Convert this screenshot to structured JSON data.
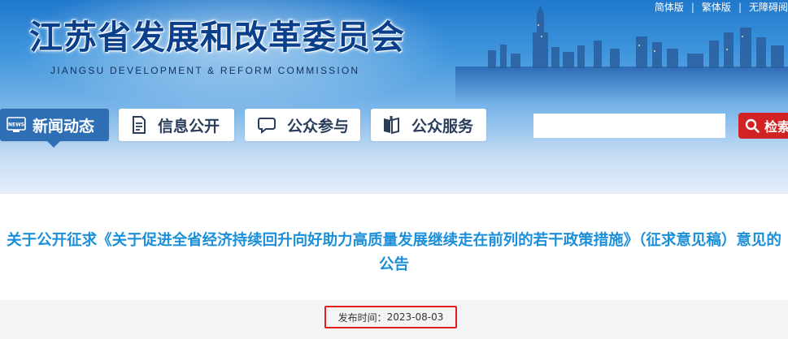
{
  "header": {
    "title": "江苏省发展和改革委员会",
    "subtitle": "JIANGSU DEVELOPMENT & REFORM COMMISSION",
    "top_links": [
      "简体版",
      "繁体版",
      "无障碍阅"
    ]
  },
  "nav": {
    "items": [
      {
        "label": "新闻动态",
        "icon": "news-icon",
        "active": true
      },
      {
        "label": "信息公开",
        "icon": "document-icon",
        "active": false
      },
      {
        "label": "公众参与",
        "icon": "chat-icon",
        "active": false
      },
      {
        "label": "公众服务",
        "icon": "book-icon",
        "active": false
      }
    ],
    "news_badge": "NEWS"
  },
  "search": {
    "placeholder": "",
    "value": "",
    "button_label": "检索"
  },
  "article": {
    "title": "关于公开征求《关于促进全省经济持续回升向好助力高质量发展继续走在前列的若干政策措施》（征求意见稿）意见的公告",
    "publish_label": "发布时间：",
    "publish_date": "2023-08-03"
  },
  "colors": {
    "nav_active": "#2e6eb4",
    "title_blue": "#1b8fd9",
    "search_red": "#d12323",
    "highlight_box": "#e02020"
  }
}
